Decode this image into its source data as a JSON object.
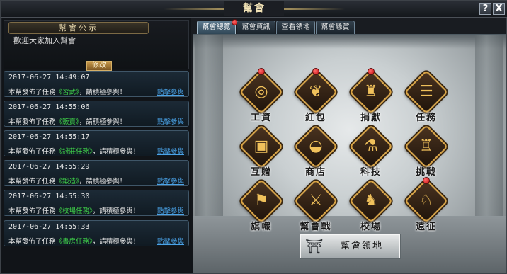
{
  "window": {
    "title": "幫會",
    "help_icon": "?",
    "close_icon": "X"
  },
  "notice": {
    "header": "幫會公示",
    "text": "歡迎大家加入幫會",
    "edit_label": "修改"
  },
  "messages": [
    {
      "time": "2017-06-27 14:49:07",
      "prefix": "本幫發佈了任務",
      "task": "《習武》",
      "suffix": "，請積極參與！",
      "link": "點擊參與"
    },
    {
      "time": "2017-06-27 14:55:06",
      "prefix": "本幫發佈了任務",
      "task": "《販賣》",
      "suffix": "，請積極參與！",
      "link": "點擊參與"
    },
    {
      "time": "2017-06-27 14:55:17",
      "prefix": "本幫發佈了任務",
      "task": "《錢莊任務》",
      "suffix": "，請積極參與！",
      "link": "點擊參與"
    },
    {
      "time": "2017-06-27 14:55:29",
      "prefix": "本幫發佈了任務",
      "task": "《鍛造》",
      "suffix": "，請積極參與！",
      "link": "點擊參與"
    },
    {
      "time": "2017-06-27 14:55:30",
      "prefix": "本幫發佈了任務",
      "task": "《校場任務》",
      "suffix": "，請積極參與！",
      "link": "點擊參與"
    },
    {
      "time": "2017-06-27 14:55:33",
      "prefix": "本幫發佈了任務",
      "task": "《書房任務》",
      "suffix": "，請積極參與！",
      "link": "點擊參與"
    }
  ],
  "tabs": [
    {
      "label": "幫會總覽",
      "active": true
    },
    {
      "label": "幫會資訊",
      "active": false
    },
    {
      "label": "查看領地",
      "active": false
    },
    {
      "label": "幫會懸賞",
      "active": false
    }
  ],
  "features": [
    {
      "label": "工資",
      "icon": "coin-icon",
      "glyph": "◎",
      "badge": true
    },
    {
      "label": "紅包",
      "icon": "red-envelope-icon",
      "glyph": "❦",
      "badge": true
    },
    {
      "label": "捐獻",
      "icon": "donation-icon",
      "glyph": "♜",
      "badge": true
    },
    {
      "label": "任務",
      "icon": "scroll-icon",
      "glyph": "☰",
      "badge": false
    },
    {
      "label": "互贈",
      "icon": "gift-box-icon",
      "glyph": "▣",
      "badge": false
    },
    {
      "label": "商店",
      "icon": "ingot-icon",
      "glyph": "◒",
      "badge": false
    },
    {
      "label": "科技",
      "icon": "technology-icon",
      "glyph": "⚗",
      "badge": false
    },
    {
      "label": "挑戰",
      "icon": "challenge-table-icon",
      "glyph": "♖",
      "badge": false
    },
    {
      "label": "旗幟",
      "icon": "banner-icon",
      "glyph": "⚑",
      "badge": false
    },
    {
      "label": "幫會戰",
      "icon": "crossed-swords-icon",
      "glyph": "⚔",
      "badge": false
    },
    {
      "label": "校場",
      "icon": "training-dummy-icon",
      "glyph": "♞",
      "badge": false
    },
    {
      "label": "遠征",
      "icon": "expedition-warrior-icon",
      "glyph": "♘",
      "badge": true
    }
  ],
  "territory_button": {
    "label": "幫會領地",
    "icon": "gate-icon",
    "glyph": "⛩"
  },
  "colors": {
    "task_highlight": "#3fd24a",
    "link": "#4aa3e8",
    "badge": "#e01414",
    "icon_border": "#d9a343"
  }
}
